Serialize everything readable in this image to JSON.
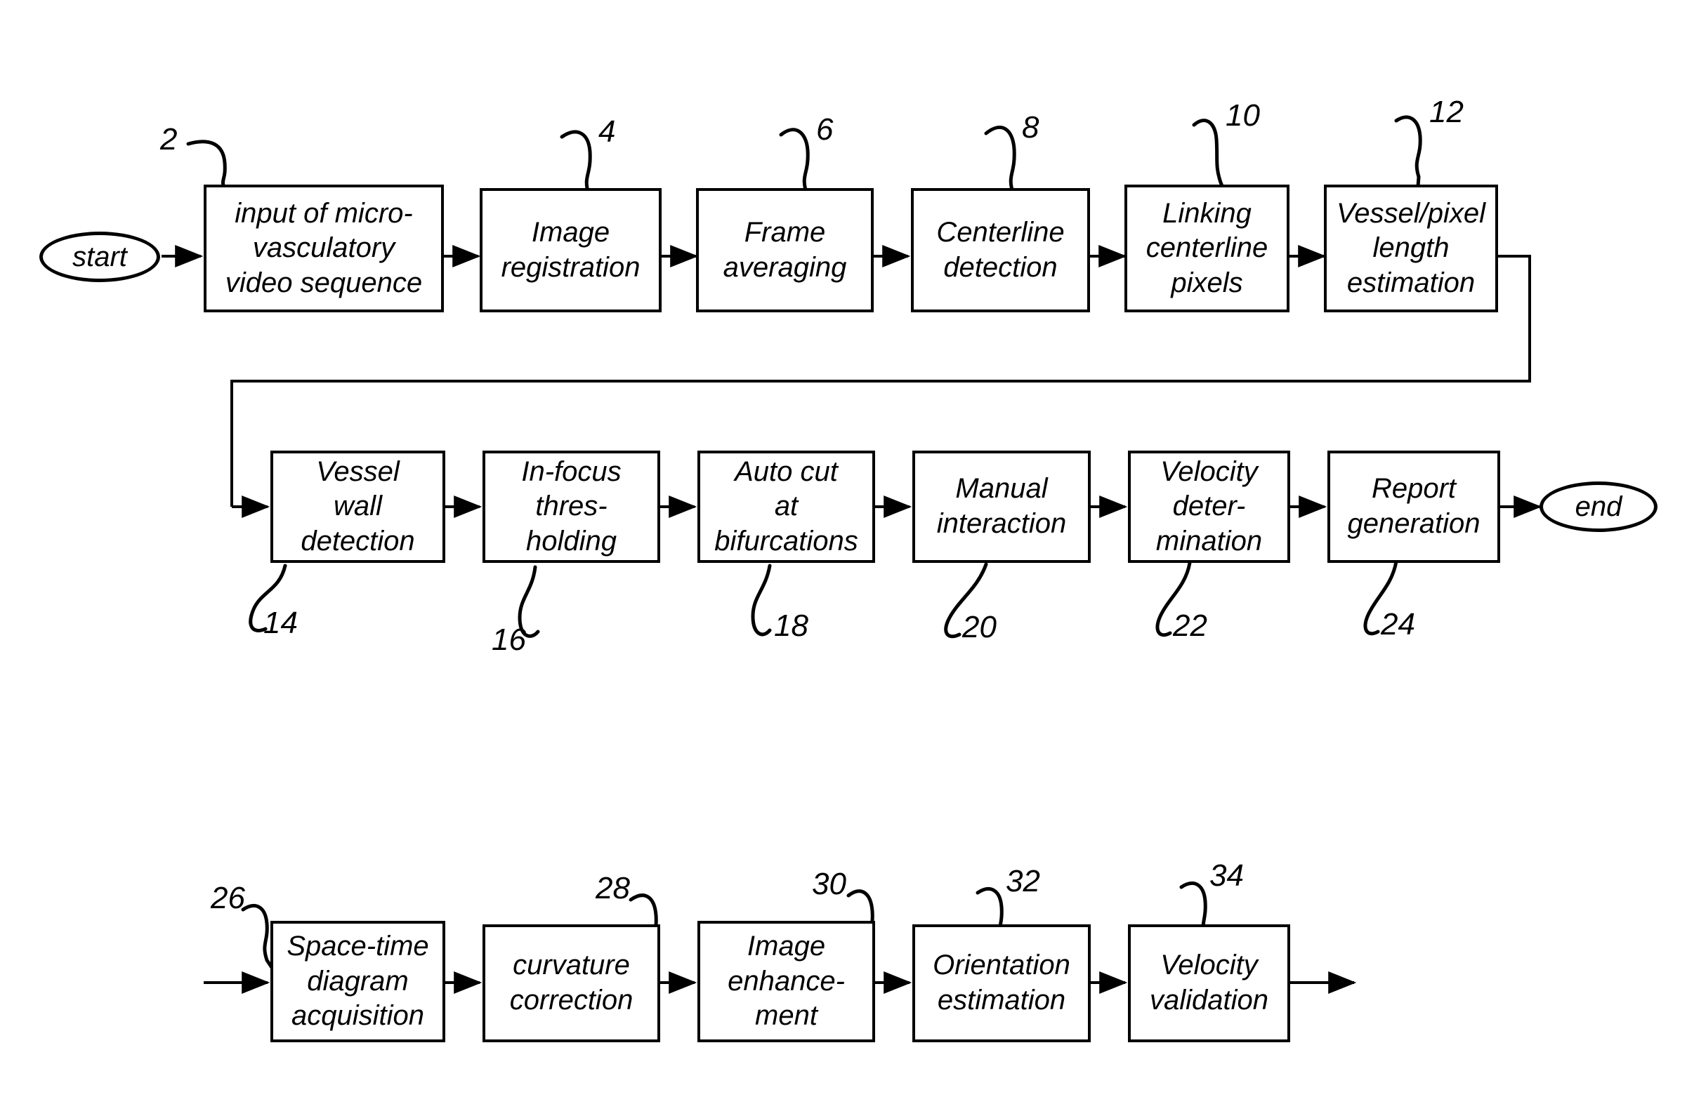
{
  "figure": {
    "title": "Micro-vascular video analysis process flowchart",
    "line_color": "#000000",
    "background_color": "#ffffff"
  },
  "terminals": {
    "start": {
      "label": "start"
    },
    "end": {
      "label": "end"
    }
  },
  "rows": {
    "row1": {
      "nodes": [
        {
          "ref": "2",
          "label": "input of micro-\nvasculatory\nvideo sequence"
        },
        {
          "ref": "4",
          "label": "Image\nregistration"
        },
        {
          "ref": "6",
          "label": "Frame\naveraging"
        },
        {
          "ref": "8",
          "label": "Centerline\ndetection"
        },
        {
          "ref": "10",
          "label": "Linking\ncenterline\npixels"
        },
        {
          "ref": "12",
          "label": "Vessel/pixel\nlength\nestimation"
        }
      ]
    },
    "row2": {
      "nodes": [
        {
          "ref": "14",
          "label": "Vessel\nwall\ndetection"
        },
        {
          "ref": "16",
          "label": "In-focus\nthres-\nholding"
        },
        {
          "ref": "18",
          "label": "Auto cut\nat\nbifurcations"
        },
        {
          "ref": "20",
          "label": "Manual\ninteraction"
        },
        {
          "ref": "22",
          "label": "Velocity\ndeter-\nmination"
        },
        {
          "ref": "24",
          "label": "Report\ngeneration"
        }
      ]
    },
    "row3": {
      "nodes": [
        {
          "ref": "26",
          "label": "Space-time\ndiagram\nacquisition"
        },
        {
          "ref": "28",
          "label": "curvature\ncorrection"
        },
        {
          "ref": "30",
          "label": "Image\nenhance-\nment"
        },
        {
          "ref": "32",
          "label": "Orientation\nestimation"
        },
        {
          "ref": "34",
          "label": "Velocity\nvalidation"
        }
      ]
    }
  }
}
